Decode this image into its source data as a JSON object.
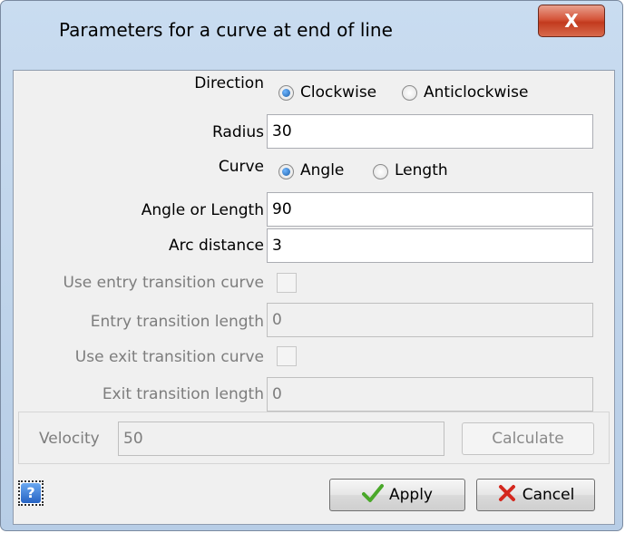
{
  "window": {
    "title": "Parameters for a curve at end of line",
    "close_glyph": "X"
  },
  "form": {
    "direction": {
      "label": "Direction",
      "options": [
        "Clockwise",
        "Anticlockwise"
      ],
      "selected": "Clockwise"
    },
    "radius": {
      "label": "Radius",
      "value": "30"
    },
    "curve": {
      "label": "Curve",
      "options": [
        "Angle",
        "Length"
      ],
      "selected": "Angle"
    },
    "angle_or_length": {
      "label": "Angle or Length",
      "value": "90"
    },
    "arc_distance": {
      "label": "Arc distance",
      "value": "3"
    },
    "use_entry_transition": {
      "label": "Use entry transition curve",
      "checked": false,
      "enabled": false
    },
    "entry_transition_length": {
      "label": "Entry transition length",
      "value": "0",
      "enabled": false
    },
    "use_exit_transition": {
      "label": "Use exit transition curve",
      "checked": false,
      "enabled": false
    },
    "exit_transition_length": {
      "label": "Exit transition length",
      "value": "0",
      "enabled": false
    },
    "velocity": {
      "label": "Velocity",
      "value": "50",
      "enabled": false
    },
    "calculate_label": "Calculate"
  },
  "buttons": {
    "help_glyph": "?",
    "apply_label": "Apply",
    "cancel_label": "Cancel"
  },
  "icons": {
    "apply": "checkmark-icon",
    "cancel": "cross-icon",
    "help": "help-icon",
    "close": "close-icon"
  },
  "colors": {
    "close_button": "#c9452a",
    "apply_check": "#4aa82a",
    "cancel_cross": "#d4281e",
    "disabled_text": "#7d7d7d"
  }
}
